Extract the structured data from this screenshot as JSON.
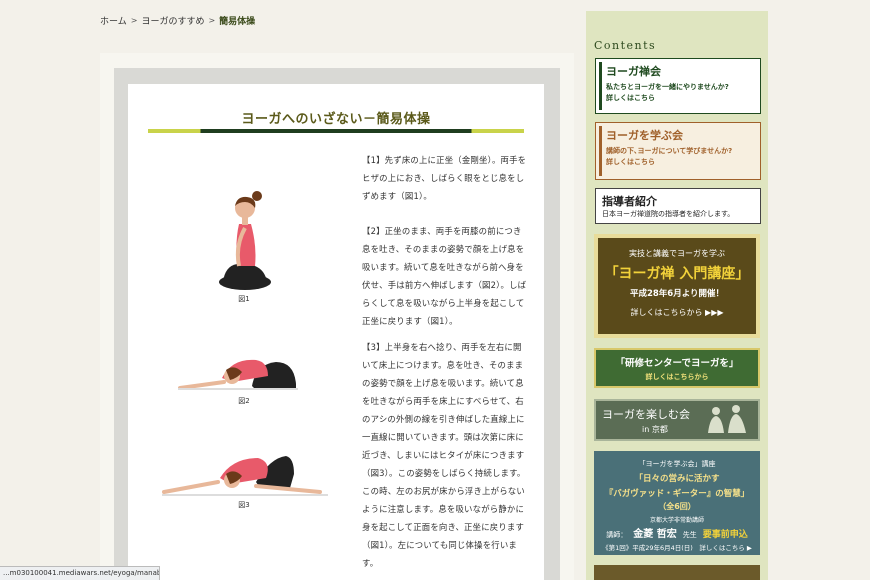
{
  "breadcrumb": {
    "home": "ホーム",
    "sep": ">",
    "parent": "ヨーガのすすめ",
    "current": "簡易体操"
  },
  "page": {
    "title": "ヨーガへのいざない－簡易体操"
  },
  "steps": [
    {
      "text": "【1】先ず床の上に正坐（金剛坐）。両手をヒザの上におき、しばらく眼をとじ息をしずめます（図1）。"
    },
    {
      "text": "【2】正坐のまま、両手を両膝の前につき息を吐き、そのままの姿勢で顔を上げ息を吸います。続いて息を吐きながら前へ身を伏せ、手は前方へ伸ばします（図2）。しばらくして息を吸いながら上半身を起こして正坐に戻ります（図1）。"
    },
    {
      "text": "【3】上半身を右へ捻り、両手を左右に開いて床上につけます。息を吐き、そのままの姿勢で顔を上げ息を吸います。続いて息を吐きながら両手を床上にすべらせて、右のアシの外側の線を引き伸ばした直線上に一直線に開いていきます。頭は次第に床に近づき、しまいにはヒタイが床につきます（図3）。この姿勢をしばらく持続します。この時、左のお尻が床から浮き上がらないように注意します。息を吸いながら静かに身を起こして正面を向き、正坐に戻ります（図1）。左についても同じ体操を行います。"
    }
  ],
  "figures": [
    {
      "label": "図1"
    },
    {
      "label": "図2"
    },
    {
      "label": "図3"
    }
  ],
  "sidebar": {
    "heading": "Contents",
    "boxes": [
      {
        "title": "ヨーガ禅会",
        "desc": "私たちとヨーガを一緒にやりませんか?",
        "more": "詳しくはこちら",
        "color": "#1f4a1f"
      },
      {
        "title": "ヨーガを学ぶ会",
        "desc": "講師の下､ヨーガについて学びませんか?",
        "more": "詳しくはこちら",
        "color": "#a0602a"
      },
      {
        "title": "指導者紹介",
        "desc": "日本ヨーガ禅道院の指導者を紹介します。",
        "more": "",
        "color": "#222222"
      }
    ],
    "banner1": {
      "top": "実技と講義でヨーガを学ぶ",
      "main": "「ヨーガ禅 入門講座」",
      "date": "平成28年6月より開催！",
      "more": "詳しくはこちらから ▶▶▶"
    },
    "banner2": {
      "main": "「研修センターでヨーガを」",
      "more": "詳しくはこちらから"
    },
    "banner3": {
      "main": "ヨーガを楽しむ会",
      "loc": "in 京都"
    },
    "banner4": {
      "top": "「ヨーガを学ぶ会」講座",
      "line1": "「日々の営みに活かす",
      "line2": "『バガヴァッド・ギーター』の智慧」",
      "line3": "（全6回）",
      "speaker_org": "京都大学非常勤講師",
      "speaker_role": "講師：",
      "speaker_name": "金菱 哲宏",
      "speaker_suffix": "先生",
      "reserve": "要事前申込",
      "bottom": "《第1回》平成29年6月4日(日)　詳しくはこちら ▶"
    }
  },
  "status": {
    "url": "...m030100041.mediawars.net/eyoga/manabu/"
  }
}
